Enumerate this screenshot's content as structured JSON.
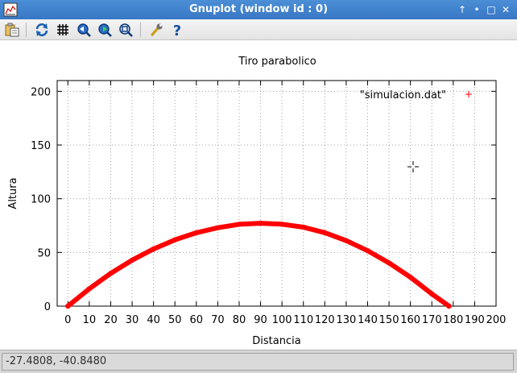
{
  "window": {
    "title": "Gnuplot (window id : 0)"
  },
  "titlebar_buttons": {
    "keep_above": "↑",
    "minimize": "•",
    "maximize": "□",
    "close": "✕"
  },
  "toolbar": {
    "items": [
      {
        "icon": "copy-to-clipboard-icon"
      },
      {
        "icon": "replot-icon"
      },
      {
        "icon": "grid-icon"
      },
      {
        "icon": "zoom-back-icon"
      },
      {
        "icon": "zoom-forward-icon"
      },
      {
        "icon": "autoscale-icon"
      },
      {
        "icon": "settings-wrench-icon"
      },
      {
        "icon": "help-icon"
      }
    ]
  },
  "status": {
    "coordinates": "-27.4808, -40.8480"
  },
  "colors": {
    "series": "#ff0000",
    "grid": "#a0a0a0",
    "titlebar": "#3d80cc"
  },
  "chart_data": {
    "type": "scatter",
    "title": "Tiro parabolico",
    "xlabel": "Distancia",
    "ylabel": "Altura",
    "xlim": [
      -5,
      200
    ],
    "ylim": [
      0,
      210
    ],
    "xticks": [
      0,
      10,
      20,
      30,
      40,
      50,
      60,
      70,
      80,
      90,
      100,
      110,
      120,
      130,
      140,
      150,
      160,
      170,
      180,
      190,
      200
    ],
    "yticks": [
      0,
      50,
      100,
      150,
      200
    ],
    "grid": true,
    "legend_position": "top-right",
    "series": [
      {
        "name": "\"simulacion.dat\"",
        "marker": "+",
        "x": [
          0,
          10,
          20,
          30,
          40,
          50,
          60,
          70,
          80,
          90,
          100,
          110,
          120,
          130,
          140,
          150,
          160,
          170,
          178
        ],
        "y": [
          0,
          16.2,
          30.5,
          42.8,
          53.2,
          61.7,
          68.3,
          73.0,
          76.2,
          77.2,
          76.3,
          73.5,
          68.4,
          61.0,
          51.6,
          40.2,
          26.9,
          11.4,
          0
        ]
      }
    ]
  }
}
